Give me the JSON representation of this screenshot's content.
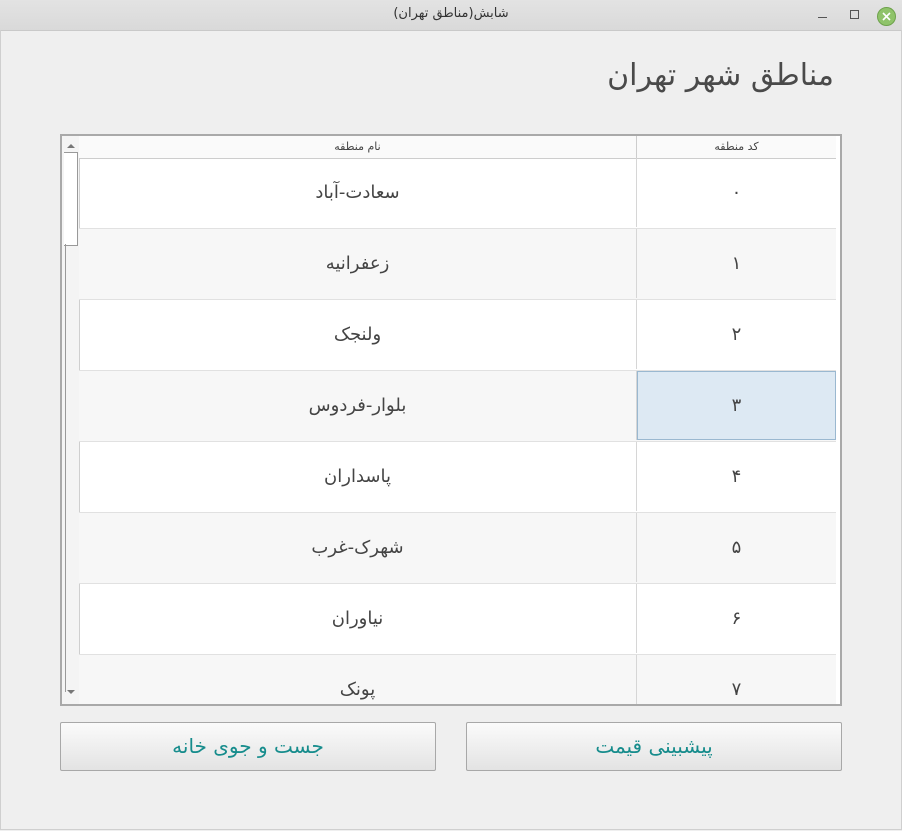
{
  "window": {
    "title": "شابش(مناطق تهران)",
    "close_color": "#8fc36a"
  },
  "heading": "مناطق شهر تهران",
  "table": {
    "headers": {
      "name": "نام منطقه",
      "code": "کد منطقه"
    },
    "rows": [
      {
        "name": "سعادت-آباد",
        "code": "۰"
      },
      {
        "name": "زعفرانیه",
        "code": "۱"
      },
      {
        "name": "ولنجک",
        "code": "۲"
      },
      {
        "name": "بلوار-فردوس",
        "code": "۳",
        "selected": true
      },
      {
        "name": "پاسداران",
        "code": "۴"
      },
      {
        "name": "شهرک-غرب",
        "code": "۵"
      },
      {
        "name": "نیاوران",
        "code": "۶"
      },
      {
        "name": "پونک",
        "code": "۷"
      }
    ]
  },
  "buttons": {
    "search": "جست و جوی خانه",
    "predict": "پیشبینی قیمت"
  },
  "colors": {
    "button_text": "#168c8c",
    "selection": "#dde9f3"
  }
}
